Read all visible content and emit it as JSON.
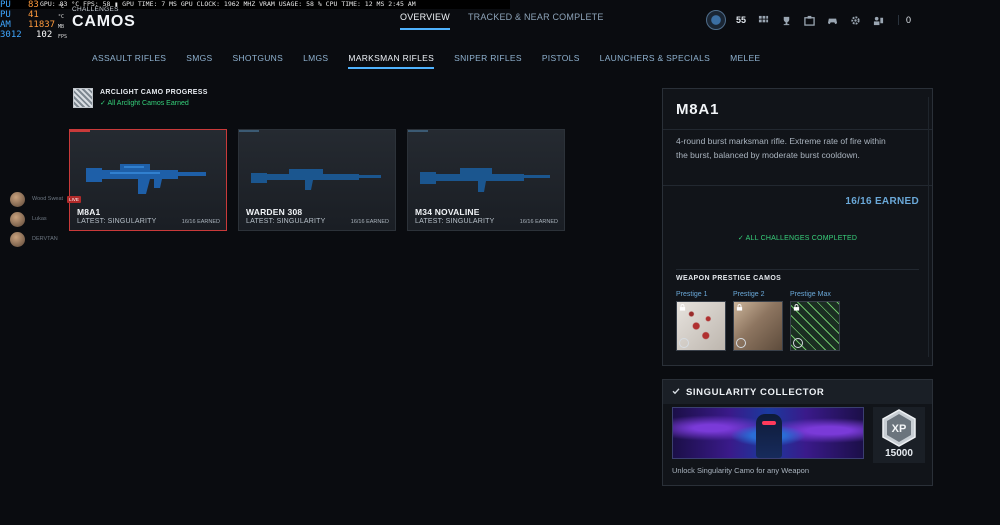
{
  "perf": {
    "bar_text": "GPU: 83 °C   FPS: 58  ▮  GPU TIME: 7 MS  GPU CLOCK: 1962 MHZ  VRAM USAGE: 58 %  CPU TIME: 12 MS  2:45 AM",
    "rows": [
      {
        "label": "PU",
        "value": "83",
        "sub": "°C",
        "value_color": "orange"
      },
      {
        "label": "PU",
        "value": "41",
        "sub": "°C",
        "value_color": "orange"
      },
      {
        "label": "AM",
        "value": "11837",
        "sub": "MB",
        "value_color": "orange"
      },
      {
        "label": "3012",
        "value": "102",
        "sub": "FPS",
        "value_color": "white"
      }
    ]
  },
  "header": {
    "subtitle": "CHALLENGES",
    "title": "CAMOS",
    "tabs": [
      {
        "label": "OVERVIEW",
        "active": true
      },
      {
        "label": "TRACKED & NEAR COMPLETE",
        "active": false
      }
    ],
    "level": "55",
    "friends_count": "0",
    "icons": [
      "grid-icon",
      "trophy-icon",
      "store-icon",
      "controller-icon",
      "settings-icon",
      "social-icon"
    ]
  },
  "categories": [
    {
      "label": "ASSAULT RIFLES",
      "active": false
    },
    {
      "label": "SMGS",
      "active": false
    },
    {
      "label": "SHOTGUNS",
      "active": false
    },
    {
      "label": "LMGS",
      "active": false
    },
    {
      "label": "MARKSMAN RIFLES",
      "active": true
    },
    {
      "label": "SNIPER RIFLES",
      "active": false
    },
    {
      "label": "PISTOLS",
      "active": false
    },
    {
      "label": "LAUNCHERS & SPECIALS",
      "active": false
    },
    {
      "label": "MELEE",
      "active": false
    }
  ],
  "arclight": {
    "title": "ARCLIGHT CAMO PROGRESS",
    "status": "All Arclight Camos Earned"
  },
  "weapons": [
    {
      "name": "M8A1",
      "latest": "LATEST: SINGULARITY",
      "earned": "16/16 EARNED",
      "selected": true
    },
    {
      "name": "WARDEN 308",
      "latest": "LATEST: SINGULARITY",
      "earned": "16/16 EARNED",
      "selected": false
    },
    {
      "name": "M34 NOVALINE",
      "latest": "LATEST: SINGULARITY",
      "earned": "16/16 EARNED",
      "selected": false
    }
  ],
  "friends": [
    {
      "name": "Wood Sweat",
      "live": "LIVE"
    },
    {
      "name": "Lukas",
      "live": ""
    },
    {
      "name": "DERVTAN",
      "live": ""
    }
  ],
  "detail": {
    "weapon_name": "M8A1",
    "description": "4-round burst marksman rifle. Extreme rate of fire within the burst, balanced by moderate burst cooldown.",
    "earned": "16/16 EARNED",
    "challenges": "ALL CHALLENGES COMPLETED",
    "prestige_title": "WEAPON PRESTIGE CAMOS",
    "prestige": [
      {
        "label": "Prestige 1",
        "locked": true
      },
      {
        "label": "Prestige 2",
        "locked": true
      },
      {
        "label": "Prestige Max",
        "locked": true
      }
    ]
  },
  "collector": {
    "title": "SINGULARITY COLLECTOR",
    "xp_badge": "XP",
    "xp_value": "15000",
    "description": "Unlock Singularity Camo for any Weapon"
  },
  "colors": {
    "accent": "#4fb3ff",
    "success": "#38d07b",
    "selected_border": "#c93a3a",
    "earned_text": "#6aa8d8"
  }
}
